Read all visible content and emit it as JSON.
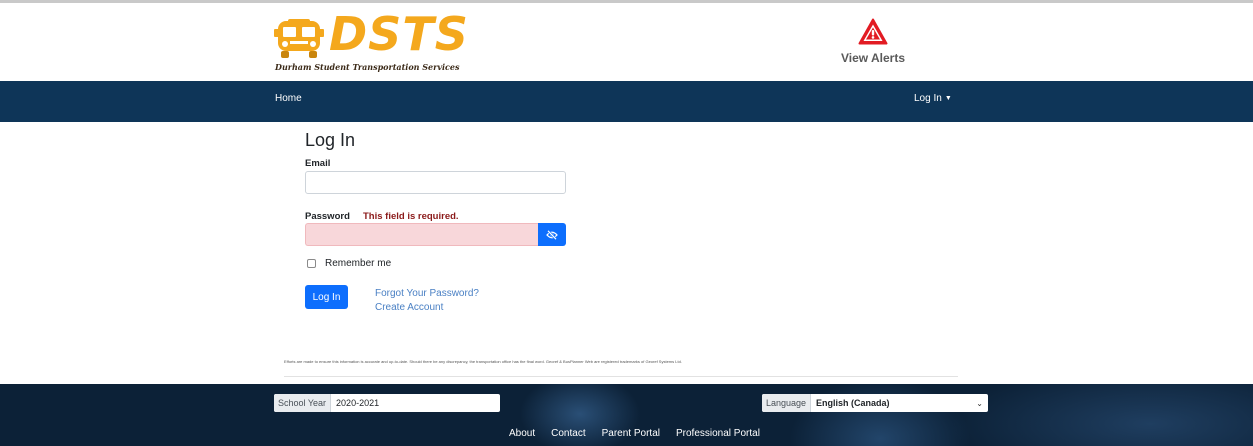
{
  "header": {
    "logo_text": "DSTS",
    "logo_subtitle": "Durham Student Transportation Services",
    "alerts_label": "View Alerts"
  },
  "nav": {
    "home": "Home",
    "login": "Log In"
  },
  "form": {
    "title": "Log In",
    "email_label": "Email",
    "email_value": "",
    "password_label": "Password",
    "password_error": "This field is required.",
    "password_value": "",
    "remember_label": "Remember me",
    "remember_checked": false,
    "login_button": "Log In",
    "forgot_link": "Forgot Your Password?",
    "create_link": "Create Account"
  },
  "disclaimer": "Efforts are made to ensure this information is accurate and up-to-date. Should there be any discrepancy, the transportation office has the final word. Georef & BusPlanner Web are registered trademarks of Georef Systems Ltd.",
  "footer": {
    "school_year_label": "School Year",
    "school_year_value": "2020-2021",
    "language_label": "Language",
    "language_value": "English (Canada)",
    "links": [
      "About",
      "Contact",
      "Parent Portal",
      "Professional Portal"
    ]
  },
  "colors": {
    "navbar": "#0e3558",
    "primary_button": "#0d6efd",
    "error_text": "#8b1a1a",
    "error_field": "#f8d7da",
    "logo": "#f4a81d",
    "alert_icon": "#e21b23"
  },
  "icons": {
    "alerts": "warning-triangle-icon",
    "password_toggle": "eye-slash-icon",
    "logo": "school-bus-icon"
  }
}
